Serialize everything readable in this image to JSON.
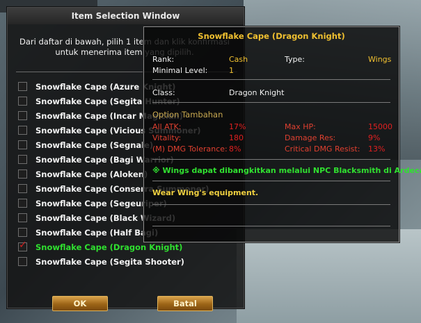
{
  "colors": {
    "accent_gold": "#f0c030",
    "selected_green": "#2fe02f",
    "stat_red": "#e02020",
    "button_orange": "#c0832f"
  },
  "selection_window": {
    "title": "Item Selection Window",
    "instruction": "Dari daftar di bawah, pilih 1 item dan klik konfirmasi untuk menerima item yang dipilih.",
    "items": [
      {
        "label": "Snowflake Cape (Azure Knight)",
        "checked": false
      },
      {
        "label": "Snowflake Cape (Segita Hunter)",
        "checked": false
      },
      {
        "label": "Snowflake Cape (Incar Magician)",
        "checked": false
      },
      {
        "label": "Snowflake Cape (Vicious Summoner)",
        "checked": false
      },
      {
        "label": "Snowflake Cape (Segnale)",
        "checked": false
      },
      {
        "label": "Snowflake Cape (Bagi Warrior)",
        "checked": false
      },
      {
        "label": "Snowflake Cape (Aloken)",
        "checked": false
      },
      {
        "label": "Snowflake Cape (Conserra Summoner)",
        "checked": false
      },
      {
        "label": "Snowflake Cape (Segeuriper)",
        "checked": false
      },
      {
        "label": "Snowflake Cape (Black Wizard)",
        "checked": false
      },
      {
        "label": "Snowflake Cape (Half Bagi)",
        "checked": false
      },
      {
        "label": "Snowflake Cape (Dragon Knight)",
        "checked": true
      },
      {
        "label": "Snowflake Cape (Segita Shooter)",
        "checked": false
      }
    ],
    "ok_label": "OK",
    "cancel_label": "Batal"
  },
  "tooltip": {
    "title": "Snowflake Cape (Dragon Knight)",
    "rank_label": "Rank:",
    "rank_value": "Cash",
    "type_label": "Type:",
    "type_value": "Wings",
    "min_level_label": "Minimal Level:",
    "min_level_value": "1",
    "class_label": "Class:",
    "class_value": "Dragon Knight",
    "option_title": "Option Tambahan",
    "options": [
      {
        "name": "All ATK:",
        "value": "17%",
        "name2": "Max HP:",
        "value2": "15000"
      },
      {
        "name": "Vitality:",
        "value": "180",
        "name2": "Damage Res:",
        "value2": "9%"
      },
      {
        "name": "(M) DMG Tolerance:",
        "value": "8%",
        "name2": "Critical DMG Resist:",
        "value2": "13%"
      }
    ],
    "awaken_note": "※ Wings dapat dibangkitkan melalui NPC Blacksmith di Ardeca.",
    "equip_note": "Wear Wing's equipment."
  }
}
